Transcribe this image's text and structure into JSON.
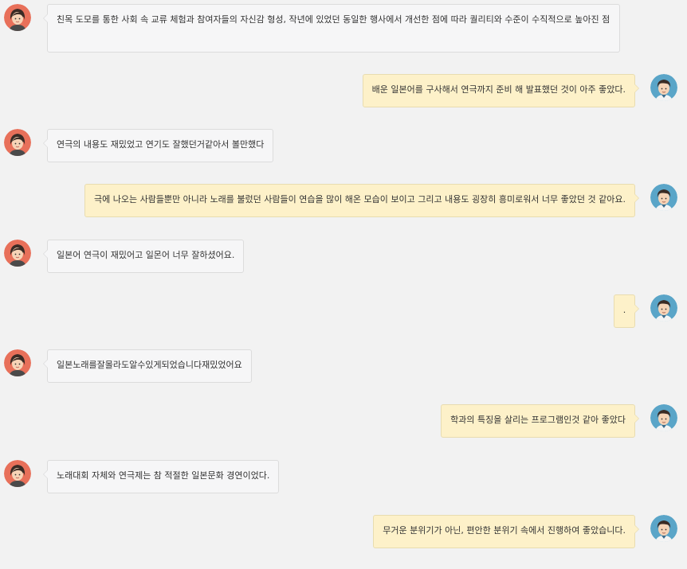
{
  "colors": {
    "background": "#f2f2f2",
    "incoming_bubble": "#f6f6f7",
    "outgoing_bubble": "#fdf1c9",
    "female_avatar_bg": "#e8705a",
    "male_avatar_bg": "#5aa5c8"
  },
  "messages": [
    {
      "side": "left",
      "avatar": "female-avatar-icon",
      "text": "친목 도모를 통한 사회 속 교류 체험과 참여자들의 자신감 형성, 작년에 있었던 동일한 행사에서 개선한 점에 따라 퀄리티와 수준이 수직적으로 높아진 점"
    },
    {
      "side": "right",
      "avatar": "male-avatar-icon",
      "text": "배운 일본어를 구사해서 연극까지 준비 해 발표했던 것이 아주 좋았다."
    },
    {
      "side": "left",
      "avatar": "female-avatar-icon",
      "text": "연극의 내용도 재밌었고 연기도 잘했던거같아서 볼만했다"
    },
    {
      "side": "right",
      "avatar": "male-avatar-icon",
      "text": "극에 나오는 사람들뿐만 아니라 노래를 불렀던 사람들이 연습을 많이 해온 모습이 보이고 그리고 내용도 굉장히 흥미로워서 너무 좋았던 것 같아요."
    },
    {
      "side": "left",
      "avatar": "female-avatar-icon",
      "text": "일본어 연극이 재밌어고 일몬어 너무 잘하셨어요."
    },
    {
      "side": "right",
      "avatar": "male-avatar-icon",
      "text": "."
    },
    {
      "side": "left",
      "avatar": "female-avatar-icon",
      "text": "일본노래를잘몰라도알수있게되었습니다재밌었어요"
    },
    {
      "side": "right",
      "avatar": "male-avatar-icon",
      "text": "학과의 특징을 살리는 프로그램인것 같아 좋았다"
    },
    {
      "side": "left",
      "avatar": "female-avatar-icon",
      "text": "노래대회 자체와 연극제는 참 적절한 일본문화 경연이었다."
    },
    {
      "side": "right",
      "avatar": "male-avatar-icon",
      "text": "무거운 분위기가 아닌, 편안한 분위기 속에서 진행하여 좋았습니다."
    }
  ]
}
